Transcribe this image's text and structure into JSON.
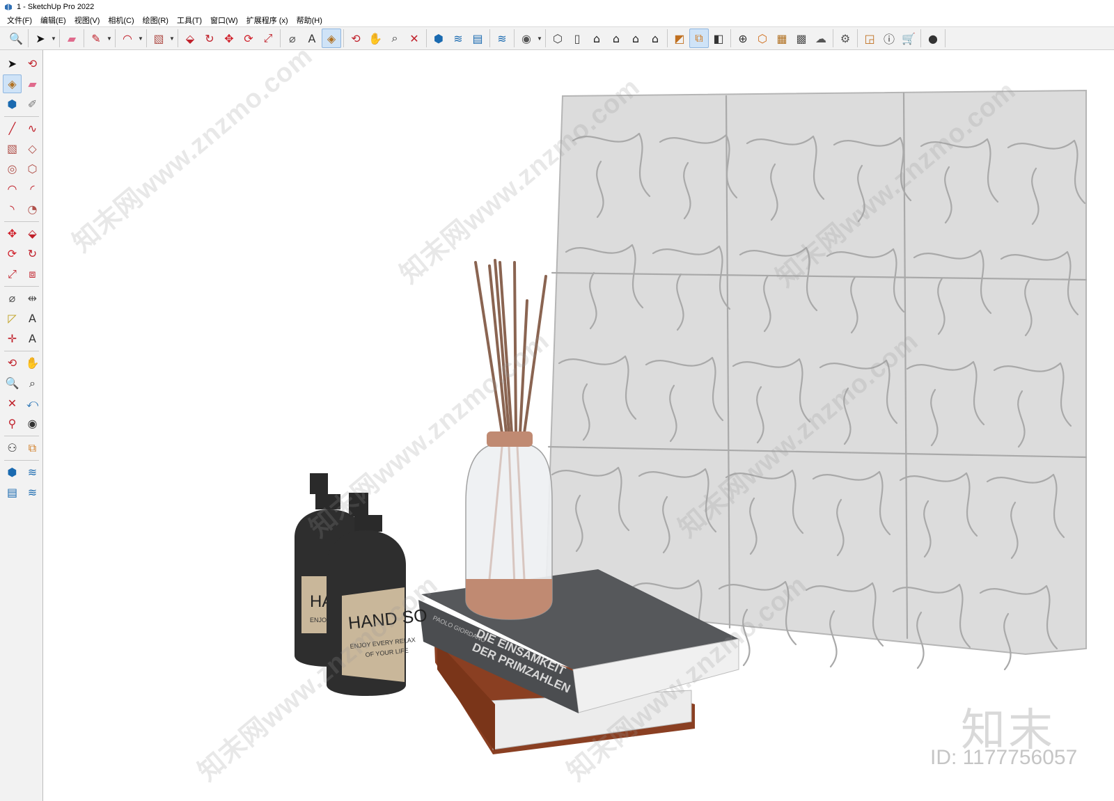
{
  "window": {
    "title": "1 - SketchUp Pro 2022"
  },
  "menu": [
    {
      "label": "文件(F)"
    },
    {
      "label": "编辑(E)"
    },
    {
      "label": "视图(V)"
    },
    {
      "label": "相机(C)"
    },
    {
      "label": "绘图(R)"
    },
    {
      "label": "工具(T)"
    },
    {
      "label": "窗口(W)"
    },
    {
      "label": "扩展程序 (x)"
    },
    {
      "label": "帮助(H)"
    }
  ],
  "toolbar": {
    "groups": [
      [
        "zoom-icon"
      ],
      [
        "select-arrow-icon",
        "dropdown"
      ],
      [
        "eraser-icon"
      ],
      [
        "pencil-icon",
        "dropdown"
      ],
      [
        "arc-icon",
        "dropdown"
      ],
      [
        "rectangle-icon",
        "dropdown"
      ],
      [
        "push-pull-icon",
        "follow-me-icon",
        "move-icon",
        "rotate-icon",
        "scale-icon"
      ],
      [
        "tape-measure-icon",
        "text-icon",
        "paint-bucket-icon"
      ],
      [
        "orbit-icon",
        "pan-icon",
        "zoom-window-icon",
        "zoom-extents-icon"
      ],
      [
        "3d-warehouse-icon",
        "extension-warehouse-icon",
        "layout-icon"
      ],
      [
        "sandbox-icon"
      ],
      [
        "user-account-icon",
        "dropdown"
      ],
      [
        "iso-view-icon",
        "top-view-icon",
        "front-view-icon",
        "right-view-icon",
        "back-view-icon",
        "left-view-icon"
      ],
      [
        "styles-icon",
        "section-plane-icon",
        "section-display-icon"
      ],
      [
        "add-location-icon",
        "photo-texture-icon",
        "reports-icon",
        "match-photo-icon",
        "cloud-upload-icon"
      ],
      [
        "settings-icon"
      ],
      [
        "instructor-icon",
        "info-icon",
        "cart-icon"
      ],
      [
        "profile-icon"
      ]
    ],
    "active": [
      "paint-bucket-icon",
      "section-plane-icon"
    ]
  },
  "left_toolbar": {
    "rows": [
      [
        "select-arrow-icon",
        "orbit-icon"
      ],
      [
        "paint-bucket-icon",
        "eraser-icon"
      ],
      [
        "make-component-icon",
        "tape-pencil-icon"
      ],
      [
        "line-icon",
        "freehand-icon"
      ],
      [
        "rectangle-icon",
        "rotated-rectangle-icon"
      ],
      [
        "circle-icon",
        "polygon-icon"
      ],
      [
        "arc-icon",
        "two-point-arc-icon"
      ],
      [
        "three-point-arc-icon",
        "pie-icon"
      ],
      [
        "move-icon",
        "push-pull-icon"
      ],
      [
        "rotate-icon",
        "follow-me-icon"
      ],
      [
        "scale-icon",
        "offset-icon"
      ],
      [
        "tape-measure-icon",
        "dimension-icon"
      ],
      [
        "protractor-icon",
        "text-icon"
      ],
      [
        "axes-icon",
        "3d-text-icon"
      ],
      [
        "orbit-icon",
        "pan-icon"
      ],
      [
        "zoom-icon",
        "zoom-window-icon"
      ],
      [
        "zoom-extents-icon",
        "previous-view-icon"
      ],
      [
        "position-camera-icon",
        "look-around-icon"
      ],
      [
        "walk-icon",
        "section-plane-icon"
      ],
      [
        "3d-warehouse-icon",
        "extension-warehouse-icon"
      ],
      [
        "layout-icon",
        "sandbox-icon"
      ]
    ],
    "active": [
      "paint-bucket-icon"
    ]
  },
  "scene": {
    "objects": [
      {
        "name": "wall-panel",
        "description_label": "3D textured wall panel"
      },
      {
        "name": "reed-diffuser",
        "description_label": "reed diffuser bottle"
      },
      {
        "name": "books",
        "description_label": "stack of books"
      },
      {
        "name": "soap-bottles",
        "description_label": "hand soap bottles"
      }
    ],
    "book_top": {
      "author": "PAOLO GIORDANO",
      "title_line1": "DIE EINSAMKEIT",
      "title_line2": "DER PRIMZAHLEN"
    },
    "soap_front": {
      "label_main": "HAND SO",
      "label_sub1": "ENJOY EVERY RELAX",
      "label_sub2": "OF YOUR LIFE"
    },
    "soap_back": {
      "label_main": "HA",
      "label_sub1": "ENJO"
    }
  },
  "watermark": {
    "text": "知末网www.znzmo.com",
    "logo": "知末",
    "id": "ID: 1177756057"
  },
  "colors": {
    "panel": "#d9d9d9",
    "panel_line": "#a8a8a8",
    "reed": "#8a6451",
    "cap": "#c08a72",
    "book_grey": "#595b5e",
    "book_brown": "#8a3f22",
    "bottle_black": "#2c2c2c",
    "label_tan": "#c9b79a"
  }
}
